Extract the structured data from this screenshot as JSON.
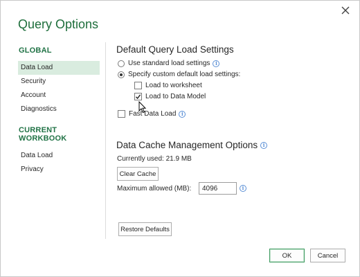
{
  "dialog": {
    "title": "Query Options",
    "close_icon": "close-icon"
  },
  "sidebar": {
    "global_heading": "GLOBAL",
    "global_items": [
      {
        "label": "Data Load",
        "selected": true
      },
      {
        "label": "Security",
        "selected": false
      },
      {
        "label": "Account",
        "selected": false
      },
      {
        "label": "Diagnostics",
        "selected": false
      }
    ],
    "workbook_heading": "CURRENT WORKBOOK",
    "workbook_items": [
      {
        "label": "Data Load",
        "selected": false
      },
      {
        "label": "Privacy",
        "selected": false
      }
    ]
  },
  "load_settings": {
    "heading": "Default Query Load Settings",
    "use_standard_label": "Use standard load settings",
    "use_standard_selected": false,
    "specify_custom_label": "Specify custom default load settings:",
    "specify_custom_selected": true,
    "load_worksheet_label": "Load to worksheet",
    "load_worksheet_checked": false,
    "load_model_label": "Load to Data Model",
    "load_model_checked": true,
    "fast_load_label": "Fast Data Load",
    "fast_load_checked": false
  },
  "cache": {
    "heading": "Data Cache Management Options",
    "currently_used": "Currently used: 21.9 MB",
    "clear_button": "Clear Cache",
    "max_label": "Maximum allowed (MB):",
    "max_value": "4096"
  },
  "footer": {
    "restore_button": "Restore Defaults",
    "ok_button": "OK",
    "cancel_button": "Cancel"
  },
  "colors": {
    "accent": "#217346",
    "title": "#1e6e3c",
    "selected_bg": "#d9ecdf",
    "info_icon": "#5a8fd6"
  }
}
